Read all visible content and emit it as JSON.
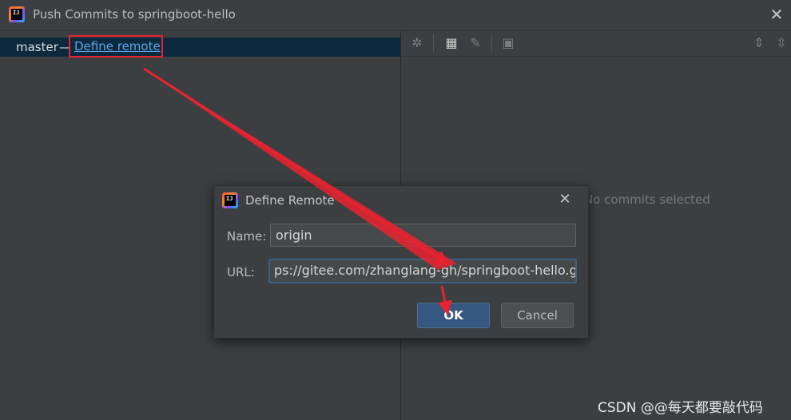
{
  "window": {
    "title": "Push Commits to springboot-hello",
    "app_icon_text": "IJ"
  },
  "branches": {
    "local": "master",
    "separator": "→",
    "remote_link": "Define remote"
  },
  "details": {
    "empty_text": "No commits selected"
  },
  "dialog": {
    "title": "Define Remote",
    "name_label": "Name:",
    "name_value": "origin",
    "url_label": "URL:",
    "url_value": "ps://gitee.com/zhanglang-gh/springboot-hello.git",
    "ok_label": "OK",
    "cancel_label": "Cancel"
  },
  "watermark": "CSDN @@每天都要敲代码",
  "colors": {
    "annotation_red": "#e8232f",
    "link_blue": "#5ea4e8",
    "selection_bg": "#0d293e"
  }
}
